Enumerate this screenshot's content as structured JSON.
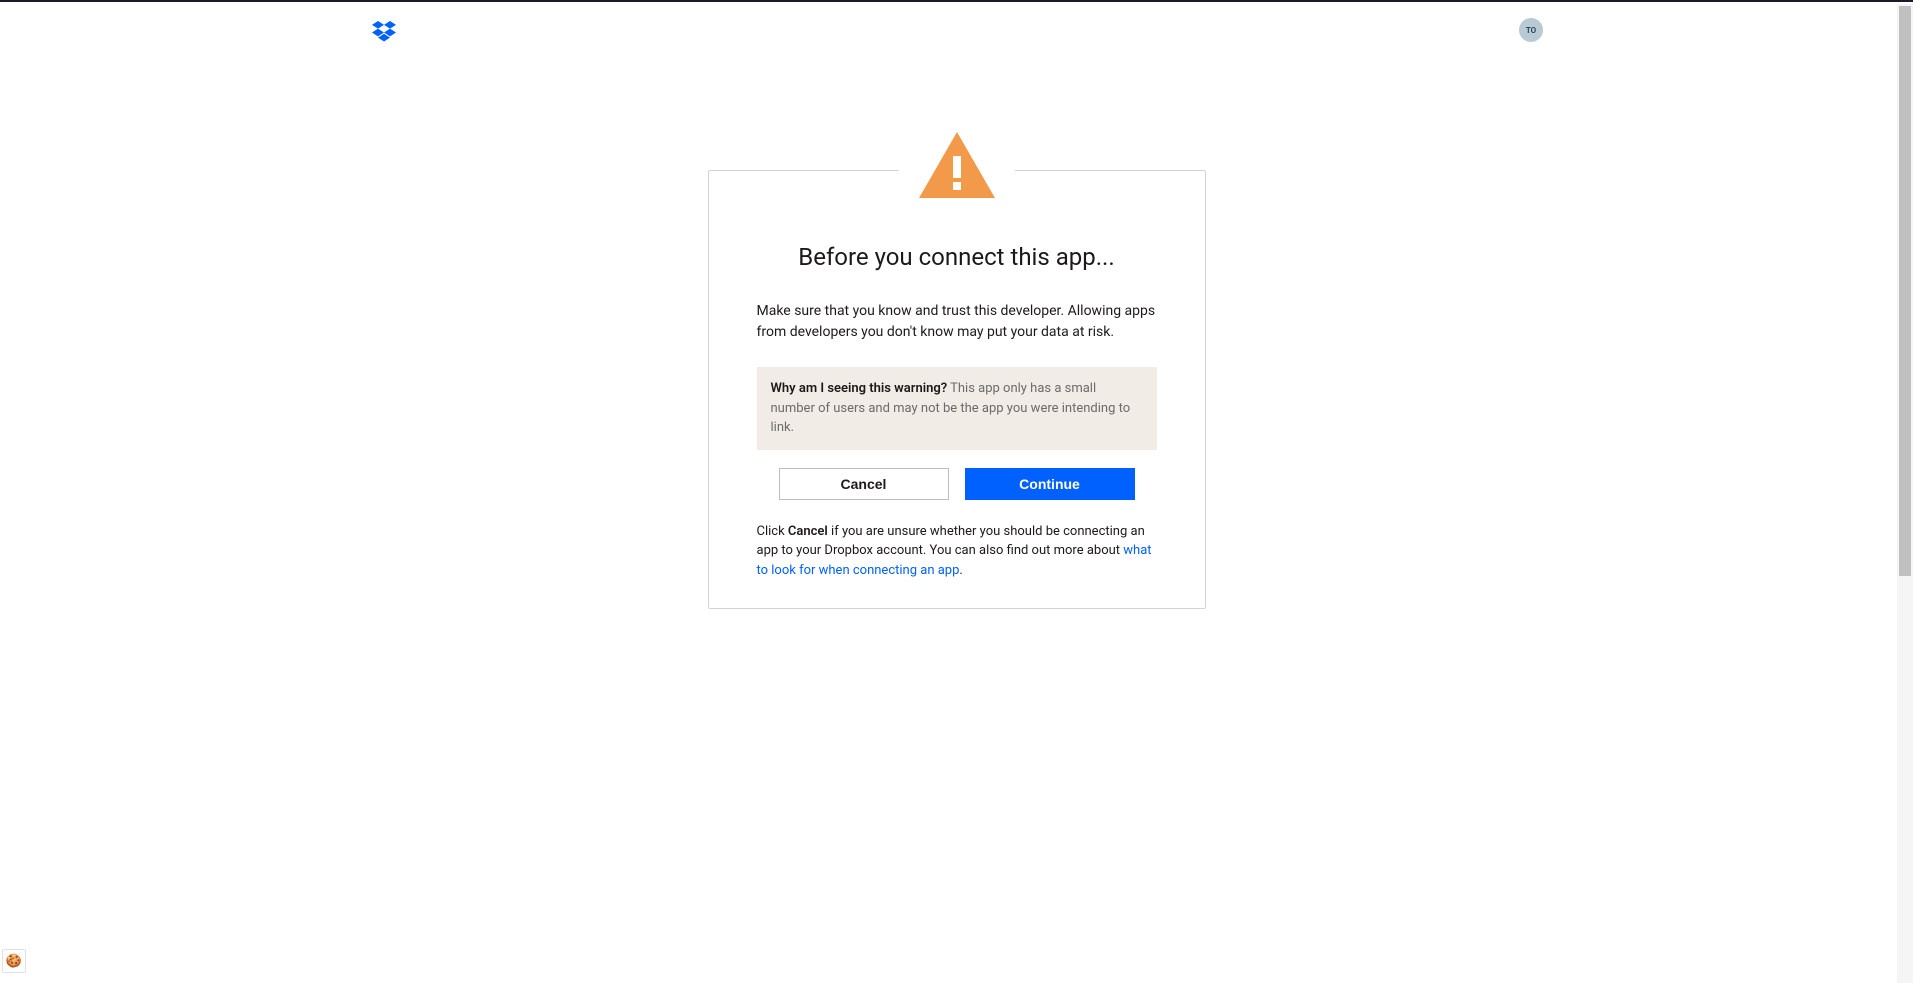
{
  "header": {
    "avatar_initials": "TO"
  },
  "dialog": {
    "title": "Before you connect this app...",
    "description": "Make sure that you know and trust this developer. Allowing apps from developers you don't know may put your data at risk.",
    "info_question": "Why am I seeing this warning?",
    "info_answer": "This app only has a small number of users and may not be the app you were intending to link.",
    "cancel_label": "Cancel",
    "continue_label": "Continue",
    "footer_prefix": "Click ",
    "footer_bold": "Cancel",
    "footer_middle": " if you are unsure whether you should be connecting an app to your Dropbox account. You can also find out more about ",
    "footer_link": "what to look for when connecting an app",
    "footer_suffix": "."
  }
}
